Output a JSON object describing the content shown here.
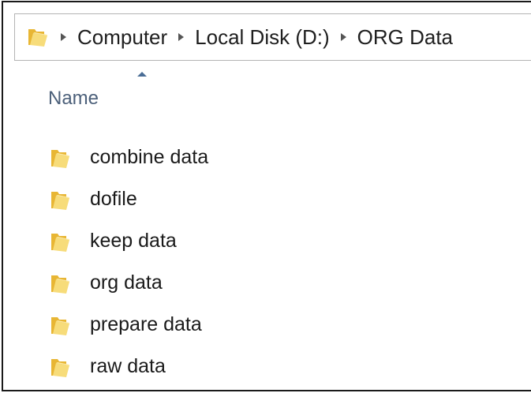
{
  "address_bar": {
    "breadcrumbs": [
      "Computer",
      "Local Disk (D:)",
      "ORG Data"
    ]
  },
  "file_view": {
    "column_header": "Name",
    "sort": "ascending",
    "items": [
      {
        "name": "combine data",
        "icon": "folder-icon"
      },
      {
        "name": "dofile",
        "icon": "folder-icon"
      },
      {
        "name": "keep data",
        "icon": "folder-icon"
      },
      {
        "name": "org data",
        "icon": "folder-icon"
      },
      {
        "name": "prepare data",
        "icon": "folder-icon"
      },
      {
        "name": "raw data",
        "icon": "folder-icon"
      }
    ]
  },
  "colors": {
    "folder_back": "#e8b634",
    "folder_front": "#f7dc7a",
    "header_text": "#4c607a",
    "sort_arrow": "#4a6d96"
  }
}
